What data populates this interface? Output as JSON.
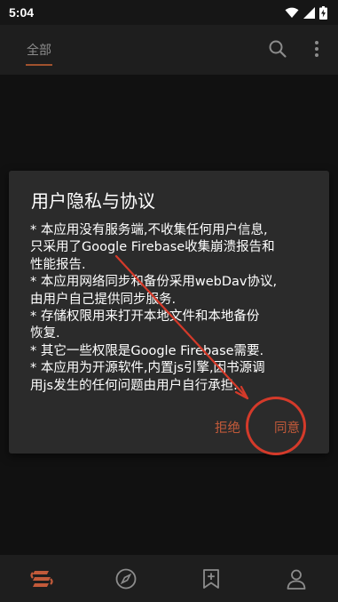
{
  "status_bar": {
    "time": "5:04",
    "icons": [
      "wifi-icon",
      "signal-icon",
      "battery-icon"
    ]
  },
  "app_bar": {
    "tab_label": "全部",
    "actions": [
      "search-icon",
      "more-vert-icon"
    ]
  },
  "dialog": {
    "title": "用户隐私与协议",
    "lines": [
      "* 本应用没有服务端,不收集任何用户信息,",
      "只采用了Google Firebase收集崩溃报告和",
      "性能报告.",
      "* 本应用网络同步和备份采用webDav协议,",
      "由用户自己提供同步服务.",
      "* 存储权限用来打开本地文件和本地备份",
      "恢复.",
      "* 其它一些权限是Google Firebase需要.",
      "* 本应用为开源软件,内置js引擎,因书源调",
      "用js发生的任何问题由用户自行承担."
    ],
    "reject_label": "拒绝",
    "agree_label": "同意"
  },
  "bottom_nav": {
    "items": [
      "bookshelf-icon",
      "explore-icon",
      "rss-bookmark-icon",
      "profile-icon"
    ]
  },
  "colors": {
    "accent": "#c25a3a",
    "annotation": "#d43a2a",
    "dialog_bg": "#2b2b2b",
    "bar_bg": "#1e1e1e"
  }
}
